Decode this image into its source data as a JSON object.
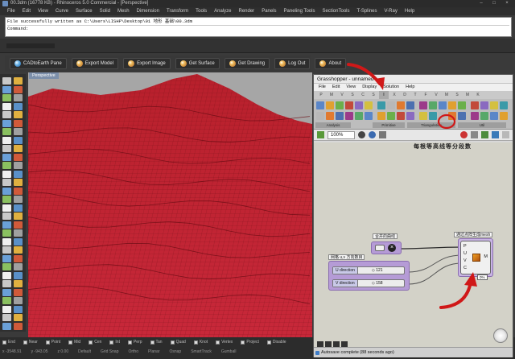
{
  "window": {
    "title": "00.3dm (16778 KB) - Rhinoceros 5.0 Commercial - [Perspective]",
    "controls": [
      "–",
      "□",
      "×"
    ]
  },
  "menu": [
    "File",
    "Edit",
    "View",
    "Curve",
    "Surface",
    "Solid",
    "Mesh",
    "Dimension",
    "Transform",
    "Tools",
    "Analyze",
    "Render",
    "Panels",
    "Paneling Tools",
    "SectionTools",
    "T-Splines",
    "V-Ray",
    "Help"
  ],
  "command": {
    "history": "File successfully written as C:\\Users\\LISHP\\Desktop\\01 地形 基础\\00.3dm",
    "prompt": "Command:"
  },
  "toolbar": {
    "cadtoearth": "CADtoEarth Pane",
    "export_model": "Export Model",
    "export_image": "Export Image",
    "get_surface": "Get Surface",
    "get_drawing": "Get Drawing",
    "logout": "Log Out",
    "about": "About"
  },
  "viewport": {
    "label": "Perspective"
  },
  "statusbar": {
    "osnaps": [
      "End",
      "Near",
      "Point",
      "Mid",
      "Cen",
      "Int",
      "Perp",
      "Tan",
      "Quad",
      "Knot",
      "Vertex",
      "Project",
      "Disable"
    ],
    "coords": [
      "x -3548.91",
      "y -943.05",
      "z 0.00",
      "Default",
      "Grid Snap",
      "Ortho",
      "Planar",
      "Osnap",
      "SmartTrack",
      "Gumball"
    ]
  },
  "gh": {
    "title": "Grasshopper - unnamed",
    "menu": [
      "File",
      "Edit",
      "View",
      "Display",
      "Solution",
      "Help"
    ],
    "tabs": [
      "P",
      "M",
      "V",
      "S",
      "C",
      "S",
      "I",
      "X",
      "D",
      "T",
      "F",
      "V",
      "M",
      "S",
      "M",
      "K"
    ],
    "groups": [
      "Analysis",
      "Primitive",
      "Triangulation",
      "Util"
    ],
    "zoom": "100%",
    "canvas_text": "每根等高线等分段数",
    "components": {
      "closed_curve_label": "合并的曲线",
      "uv_label": "网格 u,v 方向数目",
      "mesh_label": "通过点阵生成mesh",
      "u_slider": {
        "label": "U direction",
        "value": "◇ 121"
      },
      "v_slider": {
        "label": "V direction",
        "value": "◇ 158"
      },
      "mesh_inputs": [
        "P",
        "U",
        "V",
        "C"
      ],
      "mesh_output": "M",
      "count_badge": "0%"
    },
    "status": "Autosave complete (88 seconds ago)"
  },
  "colors": {
    "terrain": "#c62030",
    "annotation": "#d01818",
    "gh_group": "#b59bd6"
  }
}
